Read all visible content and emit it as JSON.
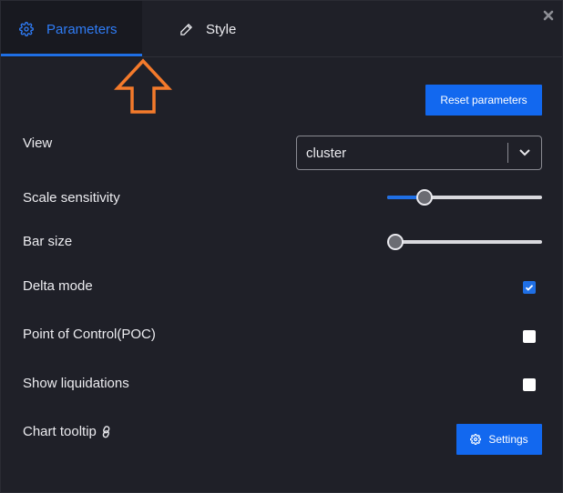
{
  "tabs": [
    {
      "label": "Parameters",
      "icon": "gear-icon",
      "active": true
    },
    {
      "label": "Style",
      "icon": "pencil-icon",
      "active": false
    }
  ],
  "buttons": {
    "reset": "Reset parameters",
    "settings": "Settings"
  },
  "rows": {
    "view": {
      "label": "View",
      "value": "cluster"
    },
    "scale_sensitivity": {
      "label": "Scale sensitivity",
      "level": 0.21
    },
    "bar_size": {
      "label": "Bar size",
      "level": 0.0
    },
    "delta_mode": {
      "label": "Delta mode",
      "checked": true
    },
    "poc": {
      "label": "Point of Control(POC)",
      "checked": false
    },
    "liquidations": {
      "label": "Show liquidations",
      "checked": false
    },
    "chart_tooltip": {
      "label": "Chart tooltip"
    }
  },
  "colors": {
    "accent": "#1f6fe5",
    "background": "#1f2028",
    "annotation_arrow": "#f47a2b"
  }
}
